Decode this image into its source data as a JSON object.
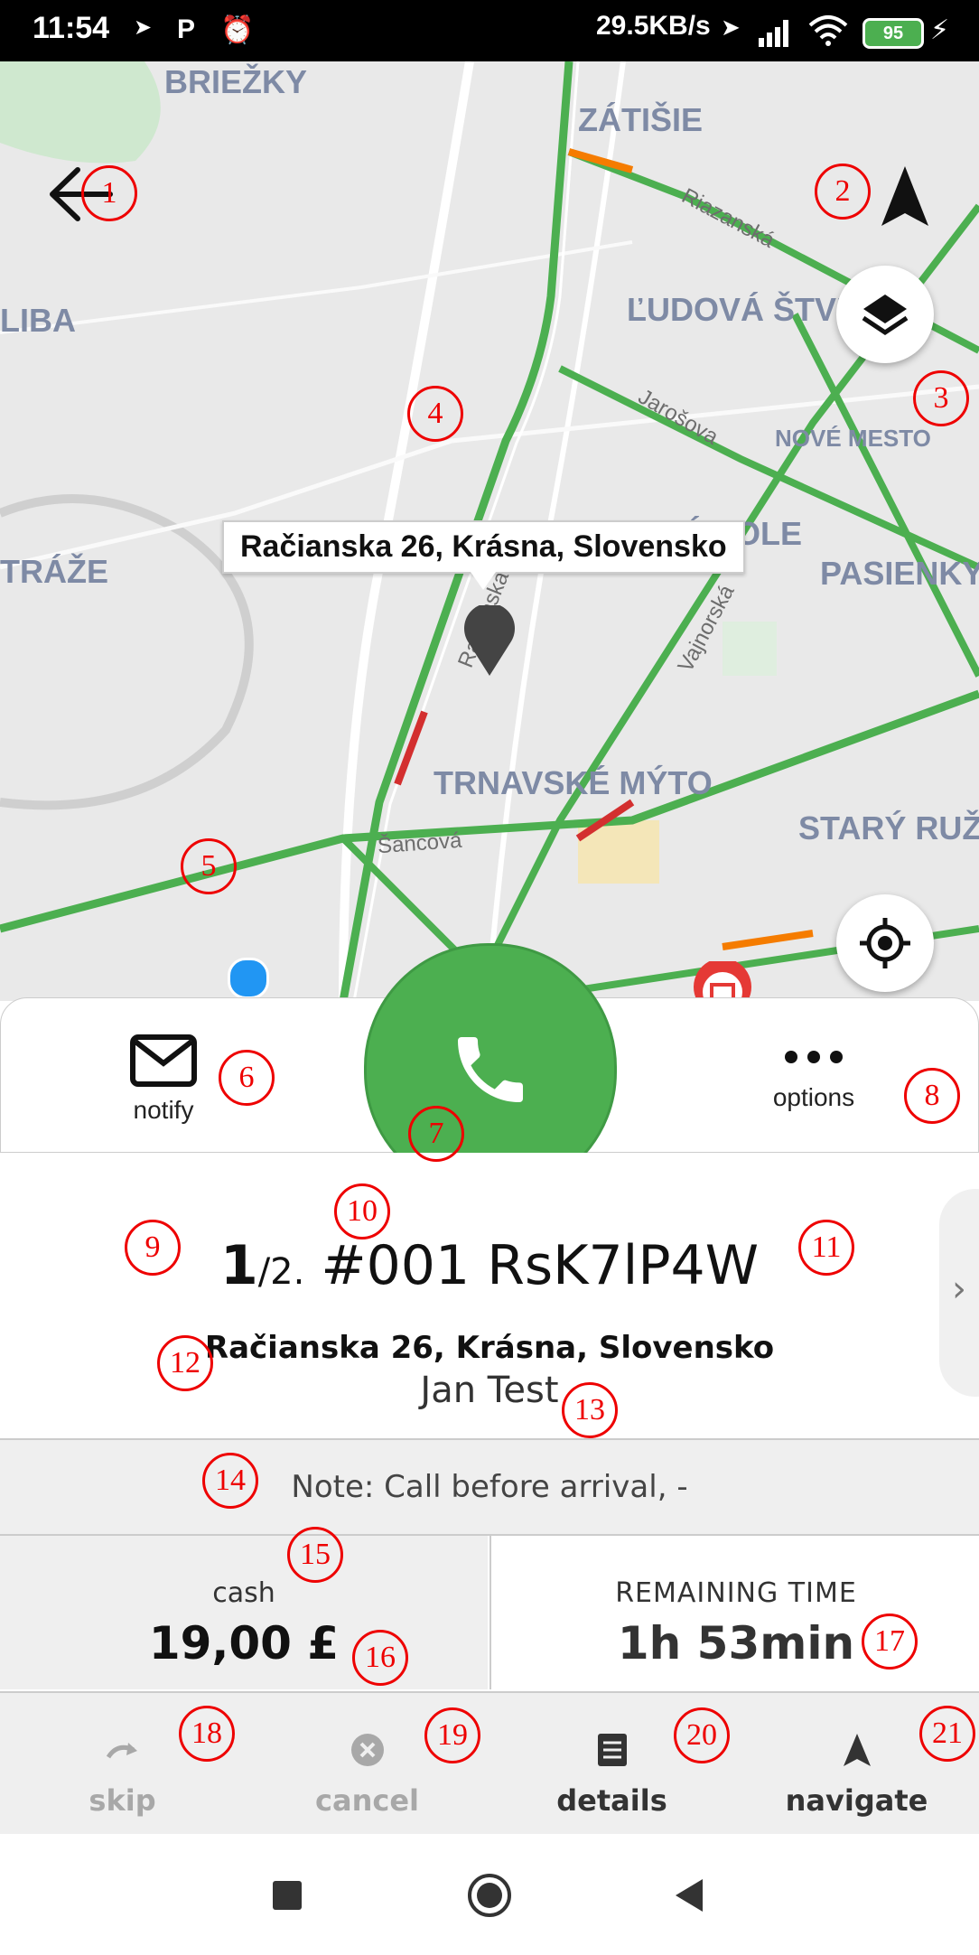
{
  "status_bar": {
    "time": "11:54",
    "network_speed": "29.5KB/s",
    "battery": "95",
    "icons": [
      "navigation-arrow-icon",
      "parking-p-icon",
      "alarm-icon",
      "location-arrow-icon",
      "signal-icon",
      "wifi-icon",
      "charging-bolt-icon"
    ]
  },
  "map": {
    "labels": [
      "BRIEŽKY",
      "ZÁTIŠIE",
      "LIBA",
      "ĽUDOVÁ ŠTVI",
      "NOVÉ MESTO",
      "TEHELNÉ POLE",
      "PASIENKY",
      "TRÁŽE",
      "TRNAVSKÉ MÝTO",
      "STARÝ RUŽ"
    ],
    "streets": [
      "Riazanská",
      "Jarošova",
      "Račianska",
      "Vajnorská",
      "Šancová"
    ],
    "tooltip": "Račianska 26, Krásna, Slovensko",
    "icons": {
      "back": "back-arrow-icon",
      "north": "navigation-north-icon",
      "layers": "layers-icon",
      "locate": "my-location-icon",
      "shop_pin": "shop-pin-icon",
      "pin": "location-pin-icon"
    }
  },
  "actions": {
    "notify_label": "notify",
    "options_label": "options"
  },
  "order": {
    "position": "1",
    "total": "/2.",
    "order_number": "#001 RsK7lP4W",
    "address": "Račianska 26, Krásna, Slovensko",
    "customer": "Jan Test",
    "note": "Note: Call before arrival, -"
  },
  "payment": {
    "method": "cash",
    "amount": "19,00 £"
  },
  "remaining": {
    "label": "REMAINING TIME",
    "value": "1h 53min"
  },
  "bottom_bar": {
    "skip": "skip",
    "cancel": "cancel",
    "details": "details",
    "navigate": "navigate"
  },
  "annotations": [
    "1",
    "2",
    "3",
    "4",
    "5",
    "6",
    "7",
    "8",
    "9",
    "10",
    "11",
    "12",
    "13",
    "14",
    "15",
    "16",
    "17",
    "18",
    "19",
    "20",
    "21"
  ],
  "colors": {
    "call_green": "#4caf50",
    "annotation_red": "#ee0000",
    "location_blue": "#2196f3",
    "traffic_green": "#4caf50",
    "traffic_orange": "#f57c00",
    "traffic_red": "#d32f2f"
  }
}
